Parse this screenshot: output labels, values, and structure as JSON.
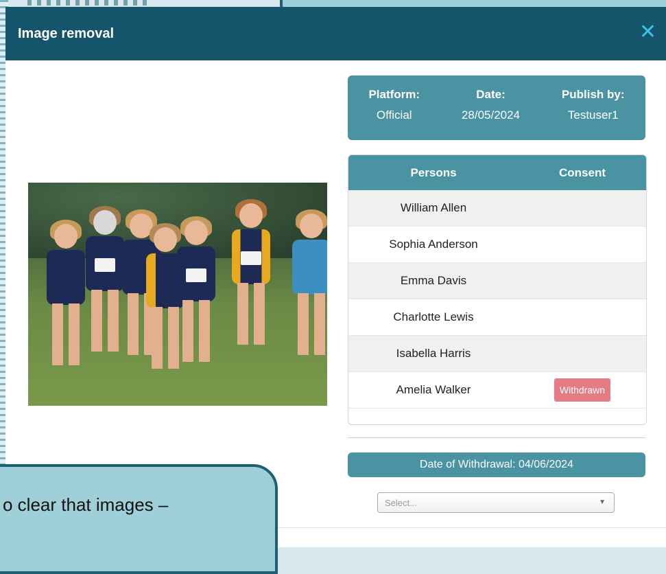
{
  "modal": {
    "title": "Image removal",
    "close_glyph": "✕"
  },
  "info": {
    "platform_label": "Platform:",
    "platform_value": "Official",
    "date_label": "Date:",
    "date_value": "28/05/2024",
    "publish_label": "Publish by:",
    "publish_value": "Testuser1"
  },
  "table": {
    "headers": {
      "persons": "Persons",
      "consent": "Consent"
    },
    "rows": [
      {
        "name": "William Allen",
        "consent": ""
      },
      {
        "name": "Sophia Anderson",
        "consent": ""
      },
      {
        "name": "Emma Davis",
        "consent": ""
      },
      {
        "name": "Charlotte Lewis",
        "consent": ""
      },
      {
        "name": "Isabella Harris",
        "consent": ""
      },
      {
        "name": "Amelia Walker",
        "consent": "Withdrawn"
      }
    ]
  },
  "withdrawal": {
    "text": "Date of Withdrawal: 04/06/2024"
  },
  "select": {
    "placeholder": "Select..."
  },
  "callout": {
    "line1": "o clear that images –",
    "line2": ""
  },
  "colors": {
    "header": "#15556b",
    "accent": "#4a93a3",
    "badge": "#e57b85",
    "callout": "#9fd0da"
  },
  "icons": {
    "close": "close-icon",
    "dropdown": "chevron-down-icon"
  }
}
